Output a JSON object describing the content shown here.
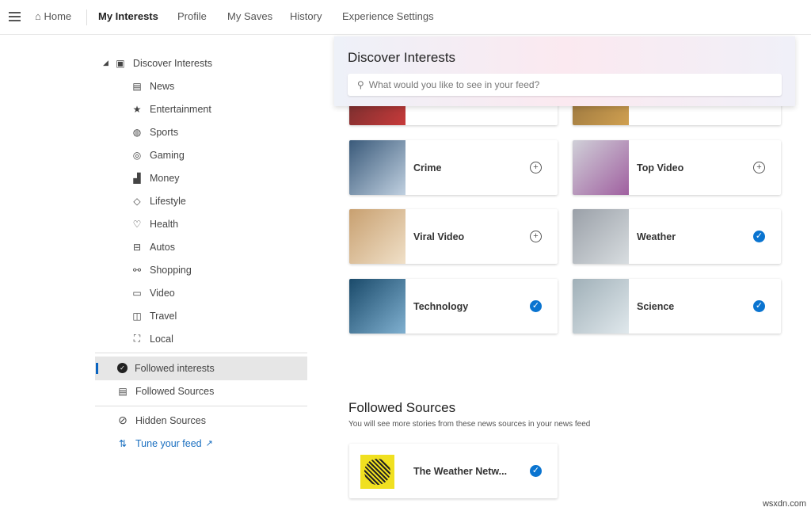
{
  "nav": {
    "home": "Home",
    "items": [
      "My Interests",
      "Profile",
      "My Saves",
      "History",
      "Experience Settings"
    ]
  },
  "sidebar": {
    "discover": "Discover Interests",
    "categories": [
      {
        "label": "News",
        "icon": "newspaper-icon",
        "g": "▤"
      },
      {
        "label": "Entertainment",
        "icon": "star-icon",
        "g": "★"
      },
      {
        "label": "Sports",
        "icon": "ball-icon",
        "g": "◍"
      },
      {
        "label": "Gaming",
        "icon": "gamepad-icon",
        "g": "◎"
      },
      {
        "label": "Money",
        "icon": "chart-icon",
        "g": "▟"
      },
      {
        "label": "Lifestyle",
        "icon": "diamond-icon",
        "g": "◇"
      },
      {
        "label": "Health",
        "icon": "heart-icon",
        "g": "♡"
      },
      {
        "label": "Autos",
        "icon": "car-icon",
        "g": "⊟"
      },
      {
        "label": "Shopping",
        "icon": "shopping-icon",
        "g": "⚯"
      },
      {
        "label": "Video",
        "icon": "video-icon",
        "g": "▭"
      },
      {
        "label": "Travel",
        "icon": "suitcase-icon",
        "g": "◫"
      },
      {
        "label": "Local",
        "icon": "location-icon",
        "g": "⛶"
      }
    ],
    "followed_interests": "Followed interests",
    "followed_sources": "Followed Sources",
    "hidden_sources": "Hidden Sources",
    "tune_feed": "Tune your feed"
  },
  "discover": {
    "title": "Discover Interests",
    "search_placeholder": "What would you like to see in your feed?"
  },
  "interests": [
    {
      "label": "",
      "followed": null,
      "colors": [
        "#5a2a2a",
        "#c83a3a"
      ]
    },
    {
      "label": "",
      "followed": null,
      "colors": [
        "#8a6a3a",
        "#d0a050"
      ]
    },
    {
      "label": "Crime",
      "followed": false,
      "colors": [
        "#3a5a7a",
        "#c0d0e0"
      ]
    },
    {
      "label": "Top Video",
      "followed": false,
      "colors": [
        "#d0d0d8",
        "#a060a0"
      ]
    },
    {
      "label": "Viral Video",
      "followed": false,
      "colors": [
        "#c8a070",
        "#f0e0c8"
      ]
    },
    {
      "label": "Weather",
      "followed": true,
      "colors": [
        "#9aa0a8",
        "#d8dde0"
      ]
    },
    {
      "label": "Technology",
      "followed": true,
      "colors": [
        "#1a4a6a",
        "#80b0d0"
      ]
    },
    {
      "label": "Science",
      "followed": true,
      "colors": [
        "#a0b0b8",
        "#e0e8ec"
      ]
    }
  ],
  "followed_sources": {
    "title": "Followed Sources",
    "subtitle": "You will see more stories from these news sources in your news feed",
    "items": [
      {
        "label": "The Weather Netw...",
        "followed": true
      }
    ]
  },
  "accent": "#0a74d0",
  "watermark": "wsxdn.com"
}
